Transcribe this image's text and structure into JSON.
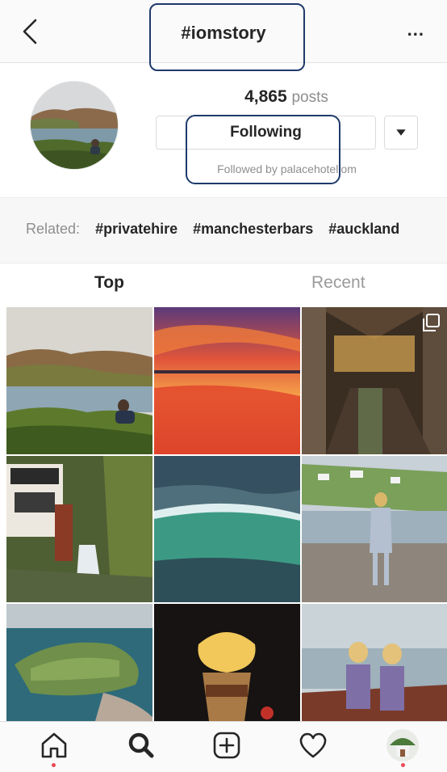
{
  "header": {
    "title": "#iomstory",
    "more_label": "..."
  },
  "profile": {
    "posts_count": "4,865",
    "posts_label": "posts",
    "follow_button_label": "Following",
    "followed_by": "Followed by palacehoteliom"
  },
  "related": {
    "label": "Related:",
    "tags": [
      "#privatehire",
      "#manchesterbars",
      "#auckland"
    ]
  },
  "tabs": [
    {
      "label": "Top",
      "active": true
    },
    {
      "label": "Recent",
      "active": false
    }
  ],
  "grid": {
    "rows": 3,
    "columns": 3,
    "multi_photo_badge_on": 3
  },
  "nav": {
    "items": [
      "home-icon",
      "search-icon",
      "new-post-icon",
      "activity-heart-icon",
      "profile-avatar"
    ],
    "active": "search-icon",
    "notification_dots_on": [
      "home-icon",
      "profile-avatar"
    ]
  },
  "colors": {
    "annotation_box": "#1f3a6b",
    "notification_dot": "#ed4956",
    "secondary_text": "#8e8e8e"
  }
}
